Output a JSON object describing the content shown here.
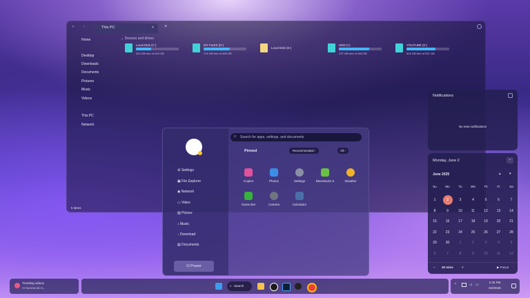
{
  "explorer": {
    "tab_title": "This PC",
    "tab_close": "×",
    "tab_add": "+",
    "section_header": "Devices and drives",
    "status": "5 items",
    "sidebar": [
      "Home",
      "Desktop",
      "Downloads",
      "Documents",
      "Pictures",
      "Music",
      "Videos",
      "This PC",
      "Network"
    ],
    "drives": [
      {
        "name": "Local Disk (C:)",
        "free": "323 GB free of 494 GB",
        "fill": 0.35
      },
      {
        "name": "MY FILES (D:)",
        "free": "176 GB free of 465 GB",
        "fill": 0.62
      },
      {
        "name": "Local Disk (E:)",
        "free": "",
        "fill": 0
      },
      {
        "name": "HDD (I:)",
        "free": "137 GB free of 465 GB",
        "fill": 0.71
      },
      {
        "name": "YOUTUBE (K:)",
        "free": "304 GB free of 931 GB",
        "fill": 0.67
      }
    ]
  },
  "start": {
    "search_placeholder": "Search for apps, settings, and documents",
    "pinned": "Pinned",
    "recommended": "Recommended  ›",
    "all": "All  ›",
    "nav": [
      "Settings",
      "File Explorer",
      "Network",
      "Video",
      "Picture",
      "Music",
      "Download",
      "Documents"
    ],
    "power": "Power",
    "apps": [
      {
        "label": "Copilot",
        "color": "#e0529a"
      },
      {
        "label": "Photos",
        "color": "#3a8ee8"
      },
      {
        "label": "Settings",
        "color": "#8a90a8"
      },
      {
        "label": "BlueStacks 5",
        "color": "#6ac242"
      },
      {
        "label": "Weather",
        "color": "#f0b228"
      },
      {
        "label": "Game Bar",
        "color": "#37b23a"
      },
      {
        "label": "Camera",
        "color": "#707582"
      },
      {
        "label": "Calculator",
        "color": "#4a6fa8"
      }
    ]
  },
  "notifications": {
    "title": "Notifications",
    "empty": "No new notifications"
  },
  "calendar": {
    "date_header": "Monday, June 2",
    "month": "June 2025",
    "weekdays": [
      "Su",
      "Mo",
      "Tu",
      "We",
      "Th",
      "Fr",
      "Sa"
    ],
    "days": [
      "1",
      "2",
      "3",
      "4",
      "5",
      "6",
      "7",
      "8",
      "9",
      "10",
      "11",
      "12",
      "13",
      "14",
      "15",
      "16",
      "17",
      "18",
      "19",
      "20",
      "21",
      "22",
      "23",
      "24",
      "25",
      "26",
      "27",
      "28",
      "29",
      "30",
      "1",
      "2",
      "3",
      "4",
      "5",
      "6",
      "7",
      "8",
      "9",
      "10",
      "11",
      "12"
    ],
    "today_index": 1,
    "focus_minus": "–",
    "focus_value": "30 mins",
    "focus_plus": "+",
    "focus_label": "▶ Focus"
  },
  "taskbar": {
    "widget_title": "Trending videos",
    "widget_sub": "AI humanoid ro...",
    "search": "Search",
    "time": "2:25 PM",
    "date": "6/2/2025",
    "tray_chevron": "^"
  },
  "colors": {
    "accent": "#42b7ff",
    "today": "#e77c70",
    "drive": "#3fd3d8"
  }
}
